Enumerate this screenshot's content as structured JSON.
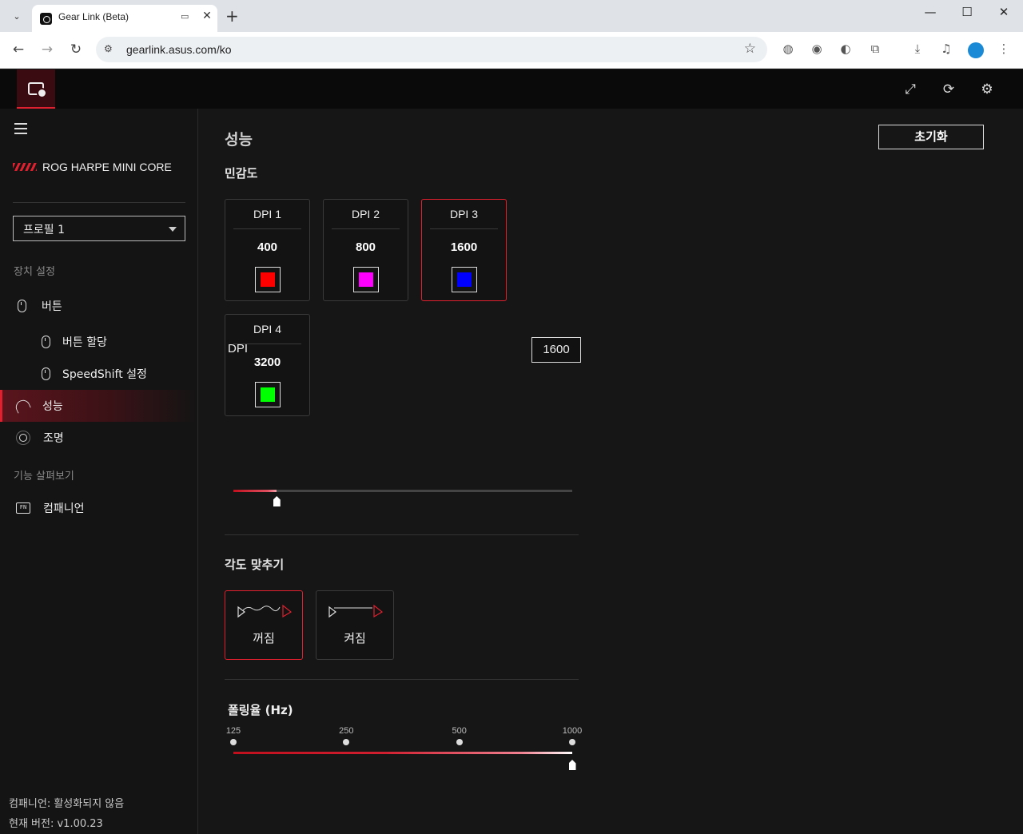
{
  "browser": {
    "tab_title": "Gear Link (Beta)",
    "url": "gearlink.asus.com/ko",
    "new_tab": "+",
    "tab_close": "✕",
    "window": {
      "minimize": "—",
      "maximize": "☐",
      "close": "✕"
    }
  },
  "header": {
    "icons": [
      "resize-icon",
      "update-check-icon",
      "gear-icon"
    ]
  },
  "sidebar": {
    "device_name": "ROG HARPE MINI CORE",
    "profile": "프로필 1",
    "section_device": "장치 설정",
    "items": [
      {
        "label": "버튼"
      },
      {
        "label": "버튼 할당"
      },
      {
        "label": "SpeedShift 설정"
      },
      {
        "label": "성능"
      },
      {
        "label": "조명"
      }
    ],
    "section_features": "기능 살펴보기",
    "companion": "컴패니언",
    "footer_status": "컴패니언: 활성화되지 않음",
    "footer_version": "현재 버전: v1.00.23"
  },
  "main": {
    "title": "성능",
    "reset_label": "초기화",
    "sensitivity_title": "민감도",
    "dpi_cards": [
      {
        "label": "DPI 1",
        "value": "400",
        "color": "#ff0000",
        "selected": false
      },
      {
        "label": "DPI 2",
        "value": "800",
        "color": "#ff00ff",
        "selected": false
      },
      {
        "label": "DPI 3",
        "value": "1600",
        "color": "#0000ff",
        "selected": true
      },
      {
        "label": "DPI 4",
        "value": "3200",
        "color": "#00ff00",
        "selected": false
      }
    ],
    "dpi_label": "DPI",
    "dpi_value": "1600",
    "dpi_slider_fraction": 0.128,
    "angle_title": "각도 맞추기",
    "angle_options": [
      {
        "label": "꺼짐",
        "selected": true
      },
      {
        "label": "켜짐",
        "selected": false
      }
    ],
    "polling_title": "폴링율 (Hz)",
    "polling_ticks": [
      "125",
      "250",
      "500",
      "1000"
    ],
    "polling_selected": "1000"
  },
  "colors": {
    "accent": "#e0202e"
  }
}
